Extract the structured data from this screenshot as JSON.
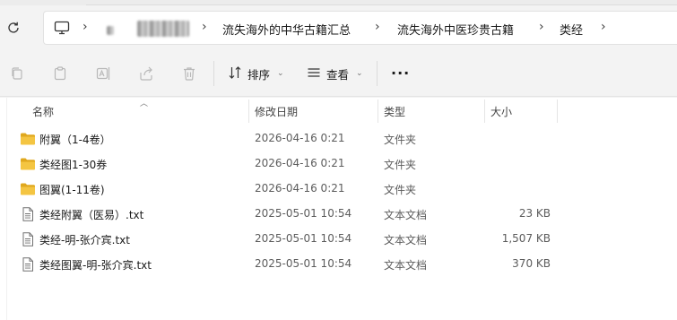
{
  "breadcrumbs": [
    {
      "label": "流失海外的中华古籍汇总"
    },
    {
      "label": "流失海外中医珍贵古籍"
    },
    {
      "label": "类经"
    }
  ],
  "toolbar": {
    "sort_label": "排序",
    "view_label": "查看",
    "more_label": "···"
  },
  "columns": {
    "name": "名称",
    "date": "修改日期",
    "type": "类型",
    "size": "大小"
  },
  "files": [
    {
      "icon": "folder-icon",
      "name": "附翼（1-4卷）",
      "date": "2026-04-16 0:21",
      "type": "文件夹",
      "size": ""
    },
    {
      "icon": "folder-icon",
      "name": "类经图1-30券",
      "date": "2026-04-16 0:21",
      "type": "文件夹",
      "size": ""
    },
    {
      "icon": "folder-icon",
      "name": "图翼(1-11卷)",
      "date": "2026-04-16 0:21",
      "type": "文件夹",
      "size": ""
    },
    {
      "icon": "text-file-icon",
      "name": "类经附翼（医易）.txt",
      "date": "2025-05-01 10:54",
      "type": "文本文档",
      "size": "23 KB"
    },
    {
      "icon": "text-file-icon",
      "name": "类经-明-张介宾.txt",
      "date": "2025-05-01 10:54",
      "type": "文本文档",
      "size": "1,507 KB"
    },
    {
      "icon": "text-file-icon",
      "name": "类经图翼-明-张介宾.txt",
      "date": "2025-05-01 10:54",
      "type": "文本文档",
      "size": "370 KB"
    }
  ],
  "colors": {
    "folder": "#f4c542",
    "folder_dark": "#e0a81e",
    "background": "#f3f3f3",
    "list_background": "#ffffff"
  }
}
